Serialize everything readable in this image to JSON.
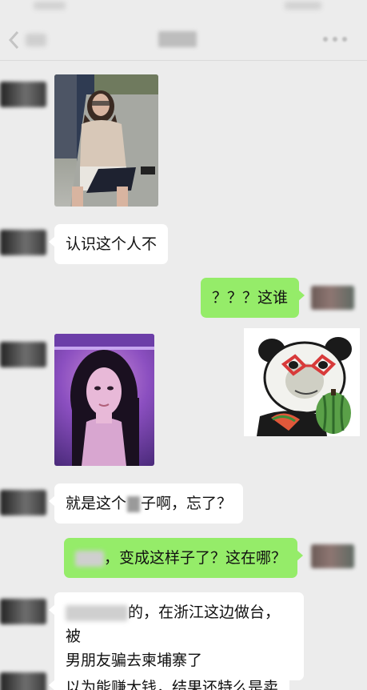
{
  "chat": {
    "title": "群聊"
  },
  "messages": [
    {
      "id": "m1",
      "side": "left",
      "type": "image",
      "image": "photo of a long-haired woman sitting outdoors holding a tablet"
    },
    {
      "id": "m2",
      "side": "left",
      "type": "text",
      "text": "认识这个人不"
    },
    {
      "id": "m3",
      "side": "right",
      "type": "text",
      "text": "？？？这谁"
    },
    {
      "id": "m4",
      "side": "left",
      "type": "image",
      "image": "portrait of a woman in purple neon light"
    },
    {
      "id": "m5",
      "side": "right",
      "type": "sticker",
      "image": "panda meme sticker with red glasses eating watermelon"
    },
    {
      "id": "m6",
      "side": "left",
      "type": "text",
      "text_before": "就是这个",
      "text_after": "子啊，忘了？"
    },
    {
      "id": "m7",
      "side": "right",
      "type": "text",
      "text": "，变成这样子了？这在哪？"
    },
    {
      "id": "m8",
      "side": "left",
      "type": "text",
      "line1": "的，在浙江这边做台，被",
      "line2": "男朋友骗去柬埔寨了"
    },
    {
      "id": "m9",
      "side": "left",
      "type": "text",
      "text": "以为能赚大钱，结果还特么是卖"
    }
  ],
  "colors": {
    "background": "#ececec",
    "incoming_bubble": "#ffffff",
    "outgoing_bubble": "#95ec69"
  }
}
